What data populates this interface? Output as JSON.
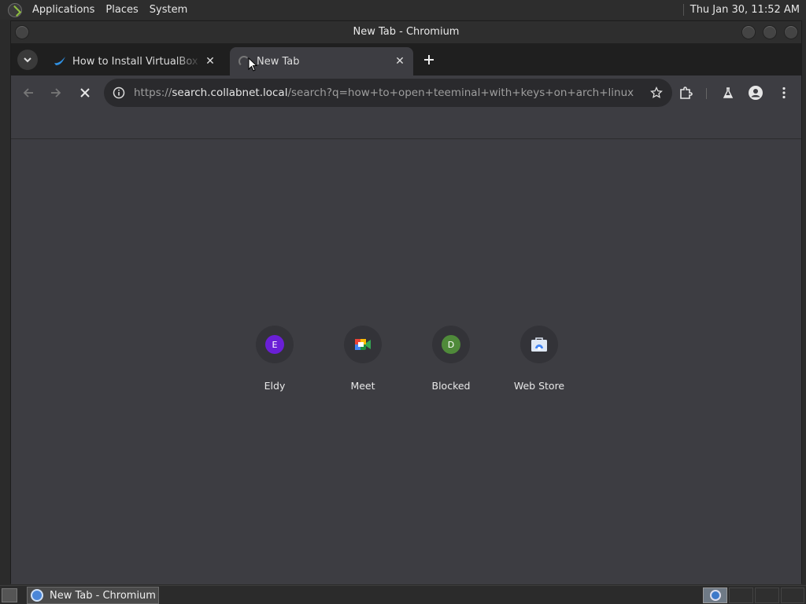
{
  "top_panel": {
    "menus": [
      "Applications",
      "Places",
      "System"
    ],
    "clock": "Thu Jan 30, 11:52 AM"
  },
  "window": {
    "title": "New Tab - Chromium"
  },
  "tabs": [
    {
      "title": "How to Install VirtualBox on",
      "favicon": "bird-icon",
      "active": false
    },
    {
      "title": "New Tab",
      "favicon": "loading-spinner",
      "active": true
    }
  ],
  "toolbar": {
    "url_host": "search.collabnet.local",
    "url_scheme": "https://",
    "url_path": "/search?q=how+to+open+teeminal+with+keys+on+arch+linux"
  },
  "shortcuts": [
    {
      "label": "Eldy",
      "letter": "E",
      "color": "#6a1fd6"
    },
    {
      "label": "Meet",
      "icon": "meet-icon"
    },
    {
      "label": "Blocked",
      "letter": "D",
      "color": "#4f8a3a"
    },
    {
      "label": "Web Store",
      "icon": "web-store-icon"
    }
  ],
  "taskbar": {
    "task_label": "New Tab - Chromium"
  }
}
